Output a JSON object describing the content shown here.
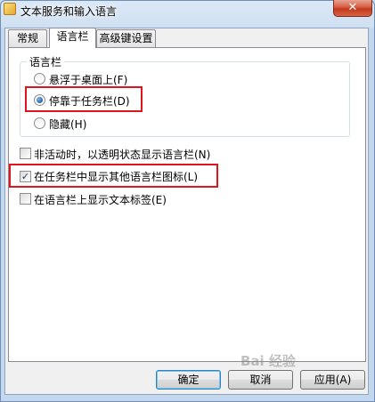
{
  "window": {
    "title": "文本服务和输入语言",
    "close_symbol": "✕"
  },
  "tabs": [
    {
      "label": "常规",
      "active": false
    },
    {
      "label": "语言栏",
      "active": true
    },
    {
      "label": "高级键设置",
      "active": false
    }
  ],
  "language_bar_group": {
    "label": "语言栏",
    "options": [
      {
        "label": "悬浮于桌面上(F)",
        "selected": false
      },
      {
        "label": "停靠于任务栏(D)",
        "selected": true
      },
      {
        "label": "隐藏(H)",
        "selected": false
      }
    ]
  },
  "checkboxes": [
    {
      "label": "非活动时，以透明状态显示语言栏(N)",
      "checked": false
    },
    {
      "label": "在任务栏中显示其他语言栏图标(L)",
      "checked": true
    },
    {
      "label": "在语言栏上显示文本标签(E)",
      "checked": false
    }
  ],
  "check_mark": "✓",
  "buttons": {
    "ok": "确定",
    "cancel": "取消",
    "apply": "应用(A)"
  },
  "watermark": "Bai 经验"
}
